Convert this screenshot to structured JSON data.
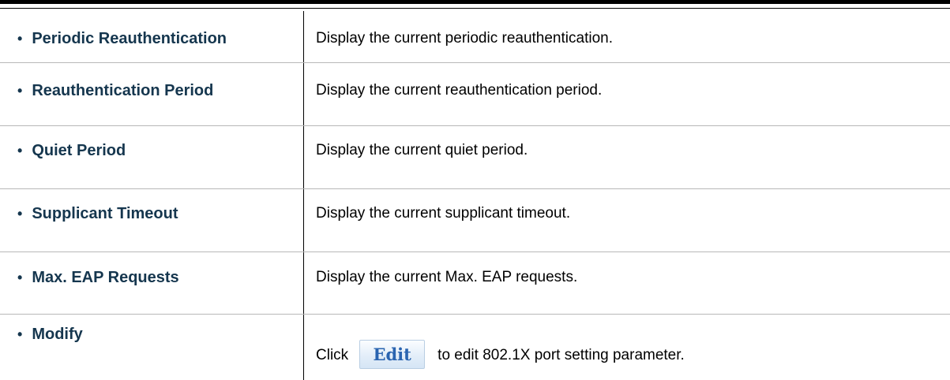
{
  "rows": [
    {
      "term": "Periodic Reauthentication",
      "description": "Display the current periodic reauthentication."
    },
    {
      "term": "Reauthentication Period",
      "description": "Display the current reauthentication period."
    },
    {
      "term": "Quiet Period",
      "description": "Display the current quiet period."
    },
    {
      "term": "Supplicant Timeout",
      "description": "Display the current supplicant timeout."
    },
    {
      "term": "Max. EAP Requests",
      "description": "Display the current Max. EAP requests."
    }
  ],
  "modify": {
    "term": "Modify",
    "prefix": "Click",
    "button_label": "Edit",
    "suffix": "to edit 802.1X port setting parameter."
  },
  "colors": {
    "term_text": "#15364e",
    "edit_button_text": "#2a64b0"
  }
}
